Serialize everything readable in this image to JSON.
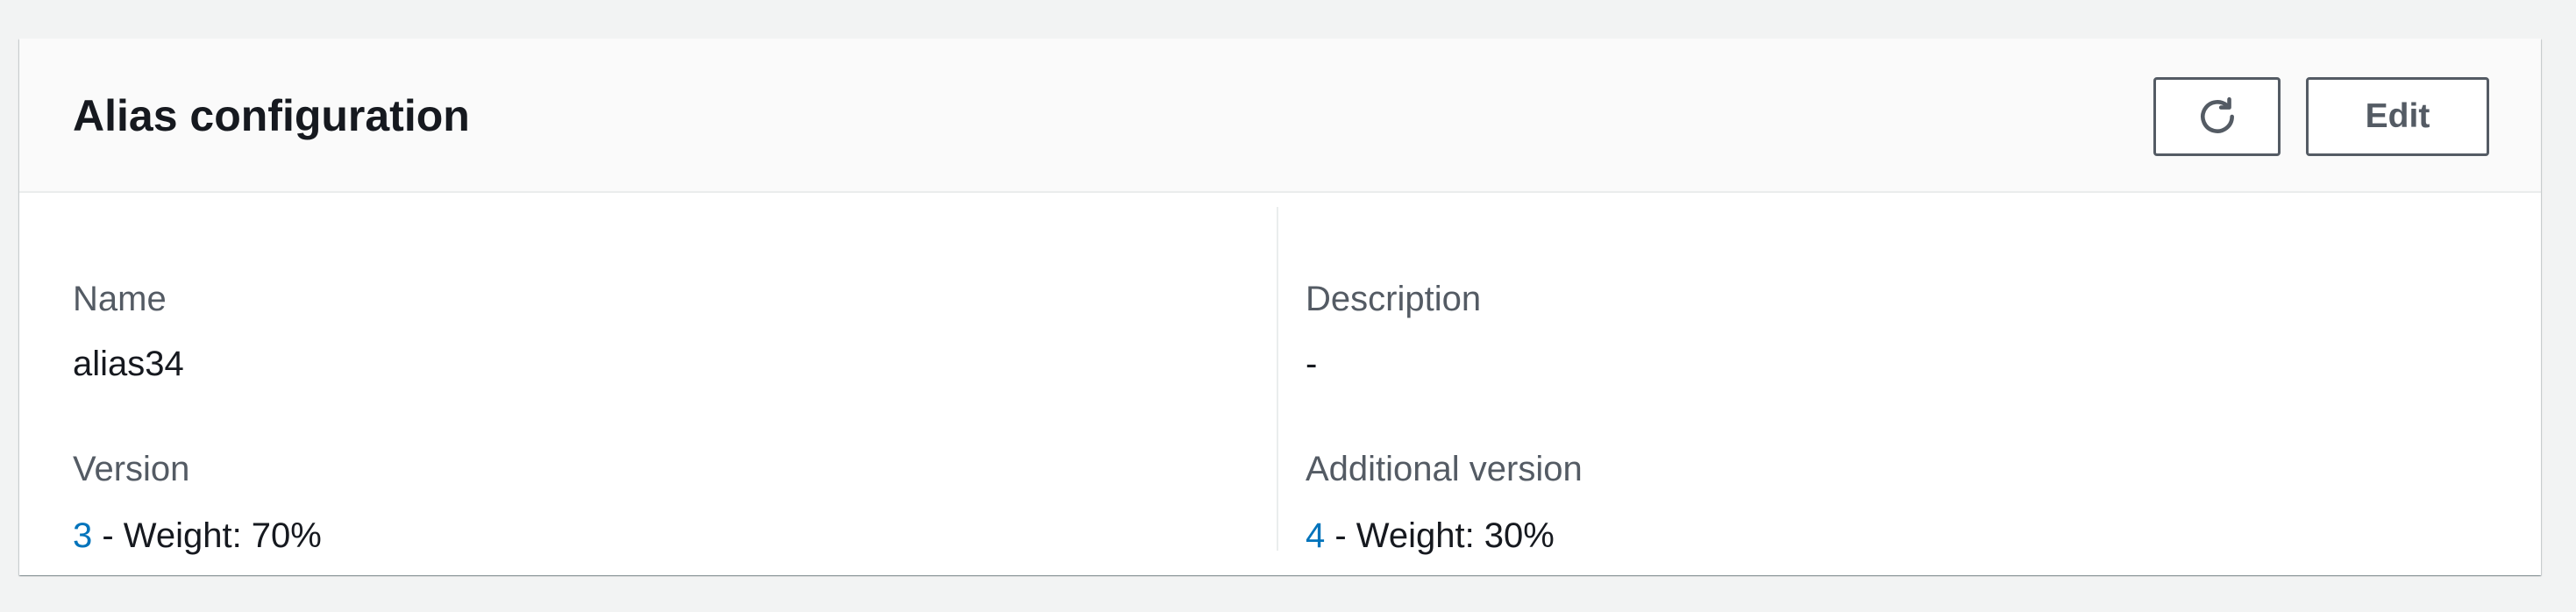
{
  "panel": {
    "title": "Alias configuration",
    "buttons": {
      "refresh_icon": "refresh-icon",
      "edit_label": "Edit"
    }
  },
  "fields": {
    "name": {
      "label": "Name",
      "value": "alias34"
    },
    "description": {
      "label": "Description",
      "value": "-"
    },
    "version": {
      "label": "Version",
      "link_text": "3",
      "suffix": " - Weight: 70%"
    },
    "additional_version": {
      "label": "Additional version",
      "link_text": "4",
      "suffix": " - Weight: 30%"
    }
  },
  "colors": {
    "background": "#f2f3f3",
    "link": "#0073bb",
    "text": "#16191f",
    "label": "#545b64",
    "border": "#545b64"
  }
}
